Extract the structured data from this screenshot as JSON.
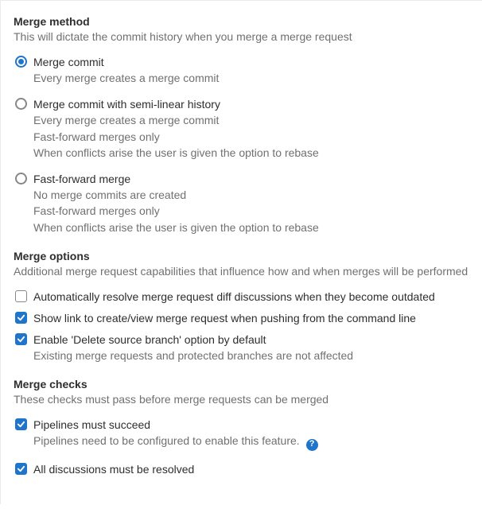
{
  "mergeMethod": {
    "title": "Merge method",
    "desc": "This will dictate the commit history when you merge a merge request",
    "options": [
      {
        "label": "Merge commit",
        "sub": [
          "Every merge creates a merge commit"
        ],
        "selected": true
      },
      {
        "label": "Merge commit with semi-linear history",
        "sub": [
          "Every merge creates a merge commit",
          "Fast-forward merges only",
          "When conflicts arise the user is given the option to rebase"
        ],
        "selected": false
      },
      {
        "label": "Fast-forward merge",
        "sub": [
          "No merge commits are created",
          "Fast-forward merges only",
          "When conflicts arise the user is given the option to rebase"
        ],
        "selected": false
      }
    ]
  },
  "mergeOptions": {
    "title": "Merge options",
    "desc": "Additional merge request capabilities that influence how and when merges will be performed",
    "items": [
      {
        "label": "Automatically resolve merge request diff discussions when they become outdated",
        "checked": false,
        "sub": []
      },
      {
        "label": "Show link to create/view merge request when pushing from the command line",
        "checked": true,
        "sub": []
      },
      {
        "label": "Enable 'Delete source branch' option by default",
        "checked": true,
        "sub": [
          "Existing merge requests and protected branches are not affected"
        ]
      }
    ]
  },
  "mergeChecks": {
    "title": "Merge checks",
    "desc": "These checks must pass before merge requests can be merged",
    "items": [
      {
        "label": "Pipelines must succeed",
        "checked": true,
        "sub": [
          "Pipelines need to be configured to enable this feature."
        ],
        "help": true
      },
      {
        "label": "All discussions must be resolved",
        "checked": true,
        "sub": []
      }
    ]
  },
  "helpGlyph": "?"
}
